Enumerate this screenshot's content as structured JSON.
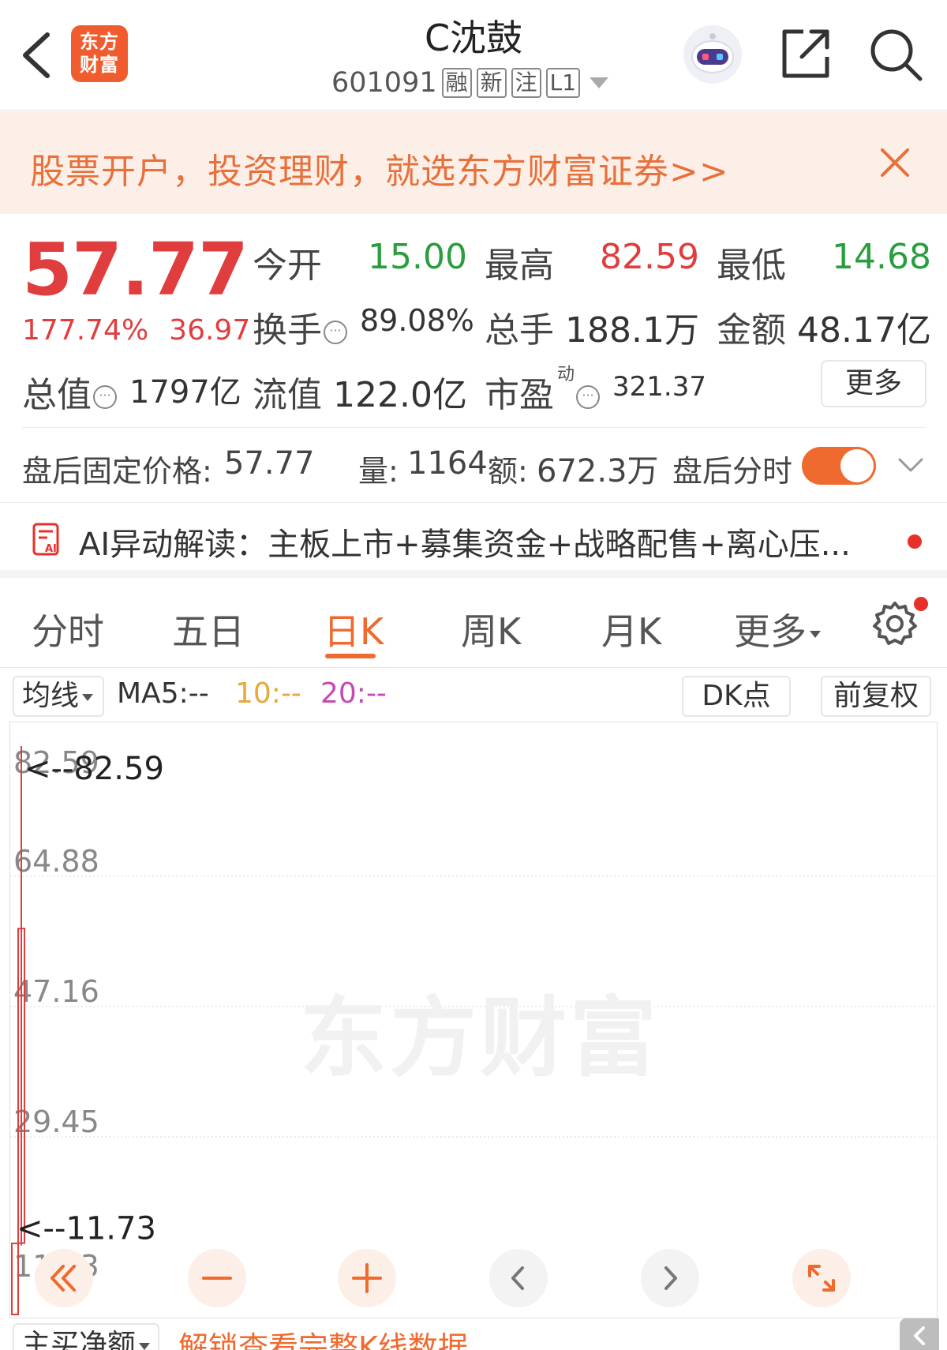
{
  "header": {
    "logo_text": "东方财富",
    "stock_name": "C沈鼓",
    "stock_code": "601091",
    "tags": [
      "融",
      "新",
      "注",
      "L1"
    ]
  },
  "banner": {
    "text": "股票开户，投资理财，就选东方财富证券>>"
  },
  "quote": {
    "price": "57.77",
    "change_pct": "177.74%",
    "change_abs": "36.97",
    "open_label": "今开",
    "open_value": "15.00",
    "high_label": "最高",
    "high_value": "82.59",
    "low_label": "最低",
    "low_value": "14.68",
    "turnover_label": "换手",
    "turnover_value": "89.08%",
    "volume_label": "总手",
    "volume_value": "188.1万",
    "amount_label": "金额",
    "amount_value": "48.17亿",
    "mktcap_label": "总值",
    "mktcap_value": "1797亿",
    "float_label": "流值",
    "float_value": "122.0亿",
    "pe_label": "市盈",
    "pe_sup": "动",
    "pe_value": "321.37",
    "more_label": "更多"
  },
  "after_hours": {
    "price_label": "盘后固定价格:",
    "price_value": "57.77",
    "vol_label": "量:",
    "vol_value": "1164",
    "amt_label": "额:",
    "amt_value": "672.3万",
    "intraday_label": "盘后分时",
    "toggle_on": true
  },
  "ai": {
    "text": "AI异动解读：主板上市+募集资金+战略配售+离心压..."
  },
  "tabs": [
    {
      "label": "分时"
    },
    {
      "label": "五日"
    },
    {
      "label": "日K",
      "active": true
    },
    {
      "label": "周K"
    },
    {
      "label": "月K"
    },
    {
      "label": "更多"
    }
  ],
  "ma_row": {
    "select_label": "均线",
    "ma5": "MA5:--",
    "ma10": "10:--",
    "ma20": "20:--",
    "dk_label": "DK点",
    "adj_label": "前复权"
  },
  "chart_data": {
    "type": "candlestick",
    "y_ticks": [
      "82.59",
      "64.88",
      "47.16",
      "29.45",
      "11.73"
    ],
    "ylim": [
      11.73,
      82.59
    ],
    "high_marker": "<--82.59",
    "low_marker": "<--11.73",
    "watermark": "东方财富",
    "candles": [
      {
        "open": 15.0,
        "close": 57.77,
        "high": 82.59,
        "low": 14.68
      }
    ]
  },
  "bottom": {
    "select_label": "主买净额",
    "unlock_text": "解锁查看完整K线数据"
  },
  "colors": {
    "accent": "#ef6a2e",
    "up": "#e03e3e",
    "down": "#2a9d3f",
    "ma10": "#e8a83b",
    "ma20": "#c44bb4"
  }
}
